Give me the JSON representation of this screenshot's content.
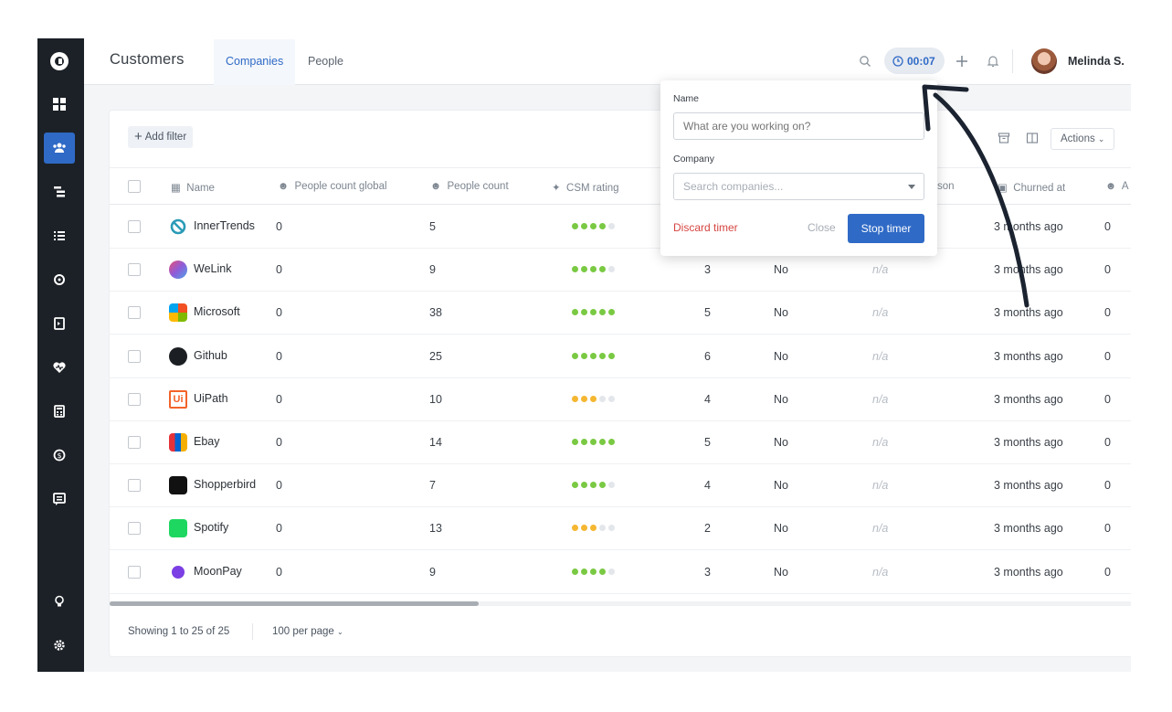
{
  "header": {
    "title": "Customers",
    "tabs": [
      {
        "label": "Companies"
      },
      {
        "label": "People"
      }
    ],
    "timer": "00:07",
    "user_name": "Melinda S."
  },
  "toolbar": {
    "add_filter": "Add filter",
    "actions": "Actions"
  },
  "table": {
    "columns": [
      "Name",
      "People count global",
      "People count",
      "CSM rating",
      "Churned at"
    ],
    "col_partial_reason": "son",
    "col_partial_a": "A",
    "rows": [
      {
        "name": "InnerTrends",
        "global": "0",
        "count": "5",
        "rating": 4,
        "rating_color": "#7ac943",
        "num": "",
        "flag": "",
        "reason": "",
        "churned": "3 months ago",
        "last": "0"
      },
      {
        "name": "WeLink",
        "global": "0",
        "count": "9",
        "rating": 4,
        "rating_color": "#7ac943",
        "num": "3",
        "flag": "No",
        "reason": "n/a",
        "churned": "3 months ago",
        "last": "0"
      },
      {
        "name": "Microsoft",
        "global": "0",
        "count": "38",
        "rating": 5,
        "rating_color": "#7ac943",
        "num": "5",
        "flag": "No",
        "reason": "n/a",
        "churned": "3 months ago",
        "last": "0"
      },
      {
        "name": "Github",
        "global": "0",
        "count": "25",
        "rating": 5,
        "rating_color": "#7ac943",
        "num": "6",
        "flag": "No",
        "reason": "n/a",
        "churned": "3 months ago",
        "last": "0"
      },
      {
        "name": "UiPath",
        "global": "0",
        "count": "10",
        "rating": 3,
        "rating_color": "#f5b731",
        "num": "4",
        "flag": "No",
        "reason": "n/a",
        "churned": "3 months ago",
        "last": "0"
      },
      {
        "name": "Ebay",
        "global": "0",
        "count": "14",
        "rating": 5,
        "rating_color": "#7ac943",
        "num": "5",
        "flag": "No",
        "reason": "n/a",
        "churned": "3 months ago",
        "last": "0"
      },
      {
        "name": "Shopperbird",
        "global": "0",
        "count": "7",
        "rating": 4,
        "rating_color": "#7ac943",
        "num": "4",
        "flag": "No",
        "reason": "n/a",
        "churned": "3 months ago",
        "last": "0"
      },
      {
        "name": "Spotify",
        "global": "0",
        "count": "13",
        "rating": 3,
        "rating_color": "#f5b731",
        "num": "2",
        "flag": "No",
        "reason": "n/a",
        "churned": "3 months ago",
        "last": "0"
      },
      {
        "name": "MoonPay",
        "global": "0",
        "count": "9",
        "rating": 4,
        "rating_color": "#7ac943",
        "num": "3",
        "flag": "No",
        "reason": "n/a",
        "churned": "3 months ago",
        "last": "0"
      }
    ]
  },
  "footer": {
    "showing": "Showing 1 to 25 of 25",
    "per_page": "100 per page"
  },
  "timer_popover": {
    "name_label": "Name",
    "name_placeholder": "What are you working on?",
    "company_label": "Company",
    "company_placeholder": "Search companies...",
    "discard": "Discard timer",
    "close": "Close",
    "stop": "Stop timer"
  },
  "colors": {
    "accent": "#2f6ac6",
    "sidebar": "#1c2127",
    "danger": "#d64541",
    "rating_empty": "#e3e6ea"
  }
}
